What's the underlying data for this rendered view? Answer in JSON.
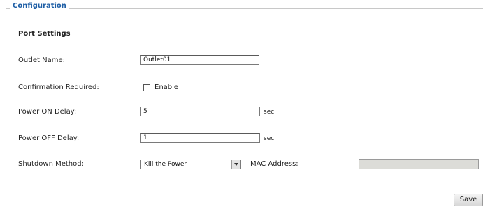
{
  "fieldset": {
    "legend": "Configuration"
  },
  "port_settings": {
    "title": "Port Settings",
    "outlet_name": {
      "label": "Outlet Name:",
      "value": "Outlet01"
    },
    "confirmation": {
      "label": "Confirmation Required:",
      "checkbox_label": "Enable",
      "checked": false
    },
    "power_on_delay": {
      "label": "Power ON Delay:",
      "value": "5",
      "unit": "sec"
    },
    "power_off_delay": {
      "label": "Power OFF Delay:",
      "value": "1",
      "unit": "sec"
    },
    "shutdown_method": {
      "label": "Shutdown Method:",
      "selected": "Kill the Power"
    },
    "mac_address": {
      "label": "MAC Address:",
      "value": ""
    }
  },
  "actions": {
    "save_label": "Save"
  },
  "colors": {
    "legend": "#1f5fa6",
    "border": "#c8c8c8",
    "disabled_input": "#dcdcd8"
  },
  "icons": {
    "dropdown": "chevron-down-icon"
  }
}
